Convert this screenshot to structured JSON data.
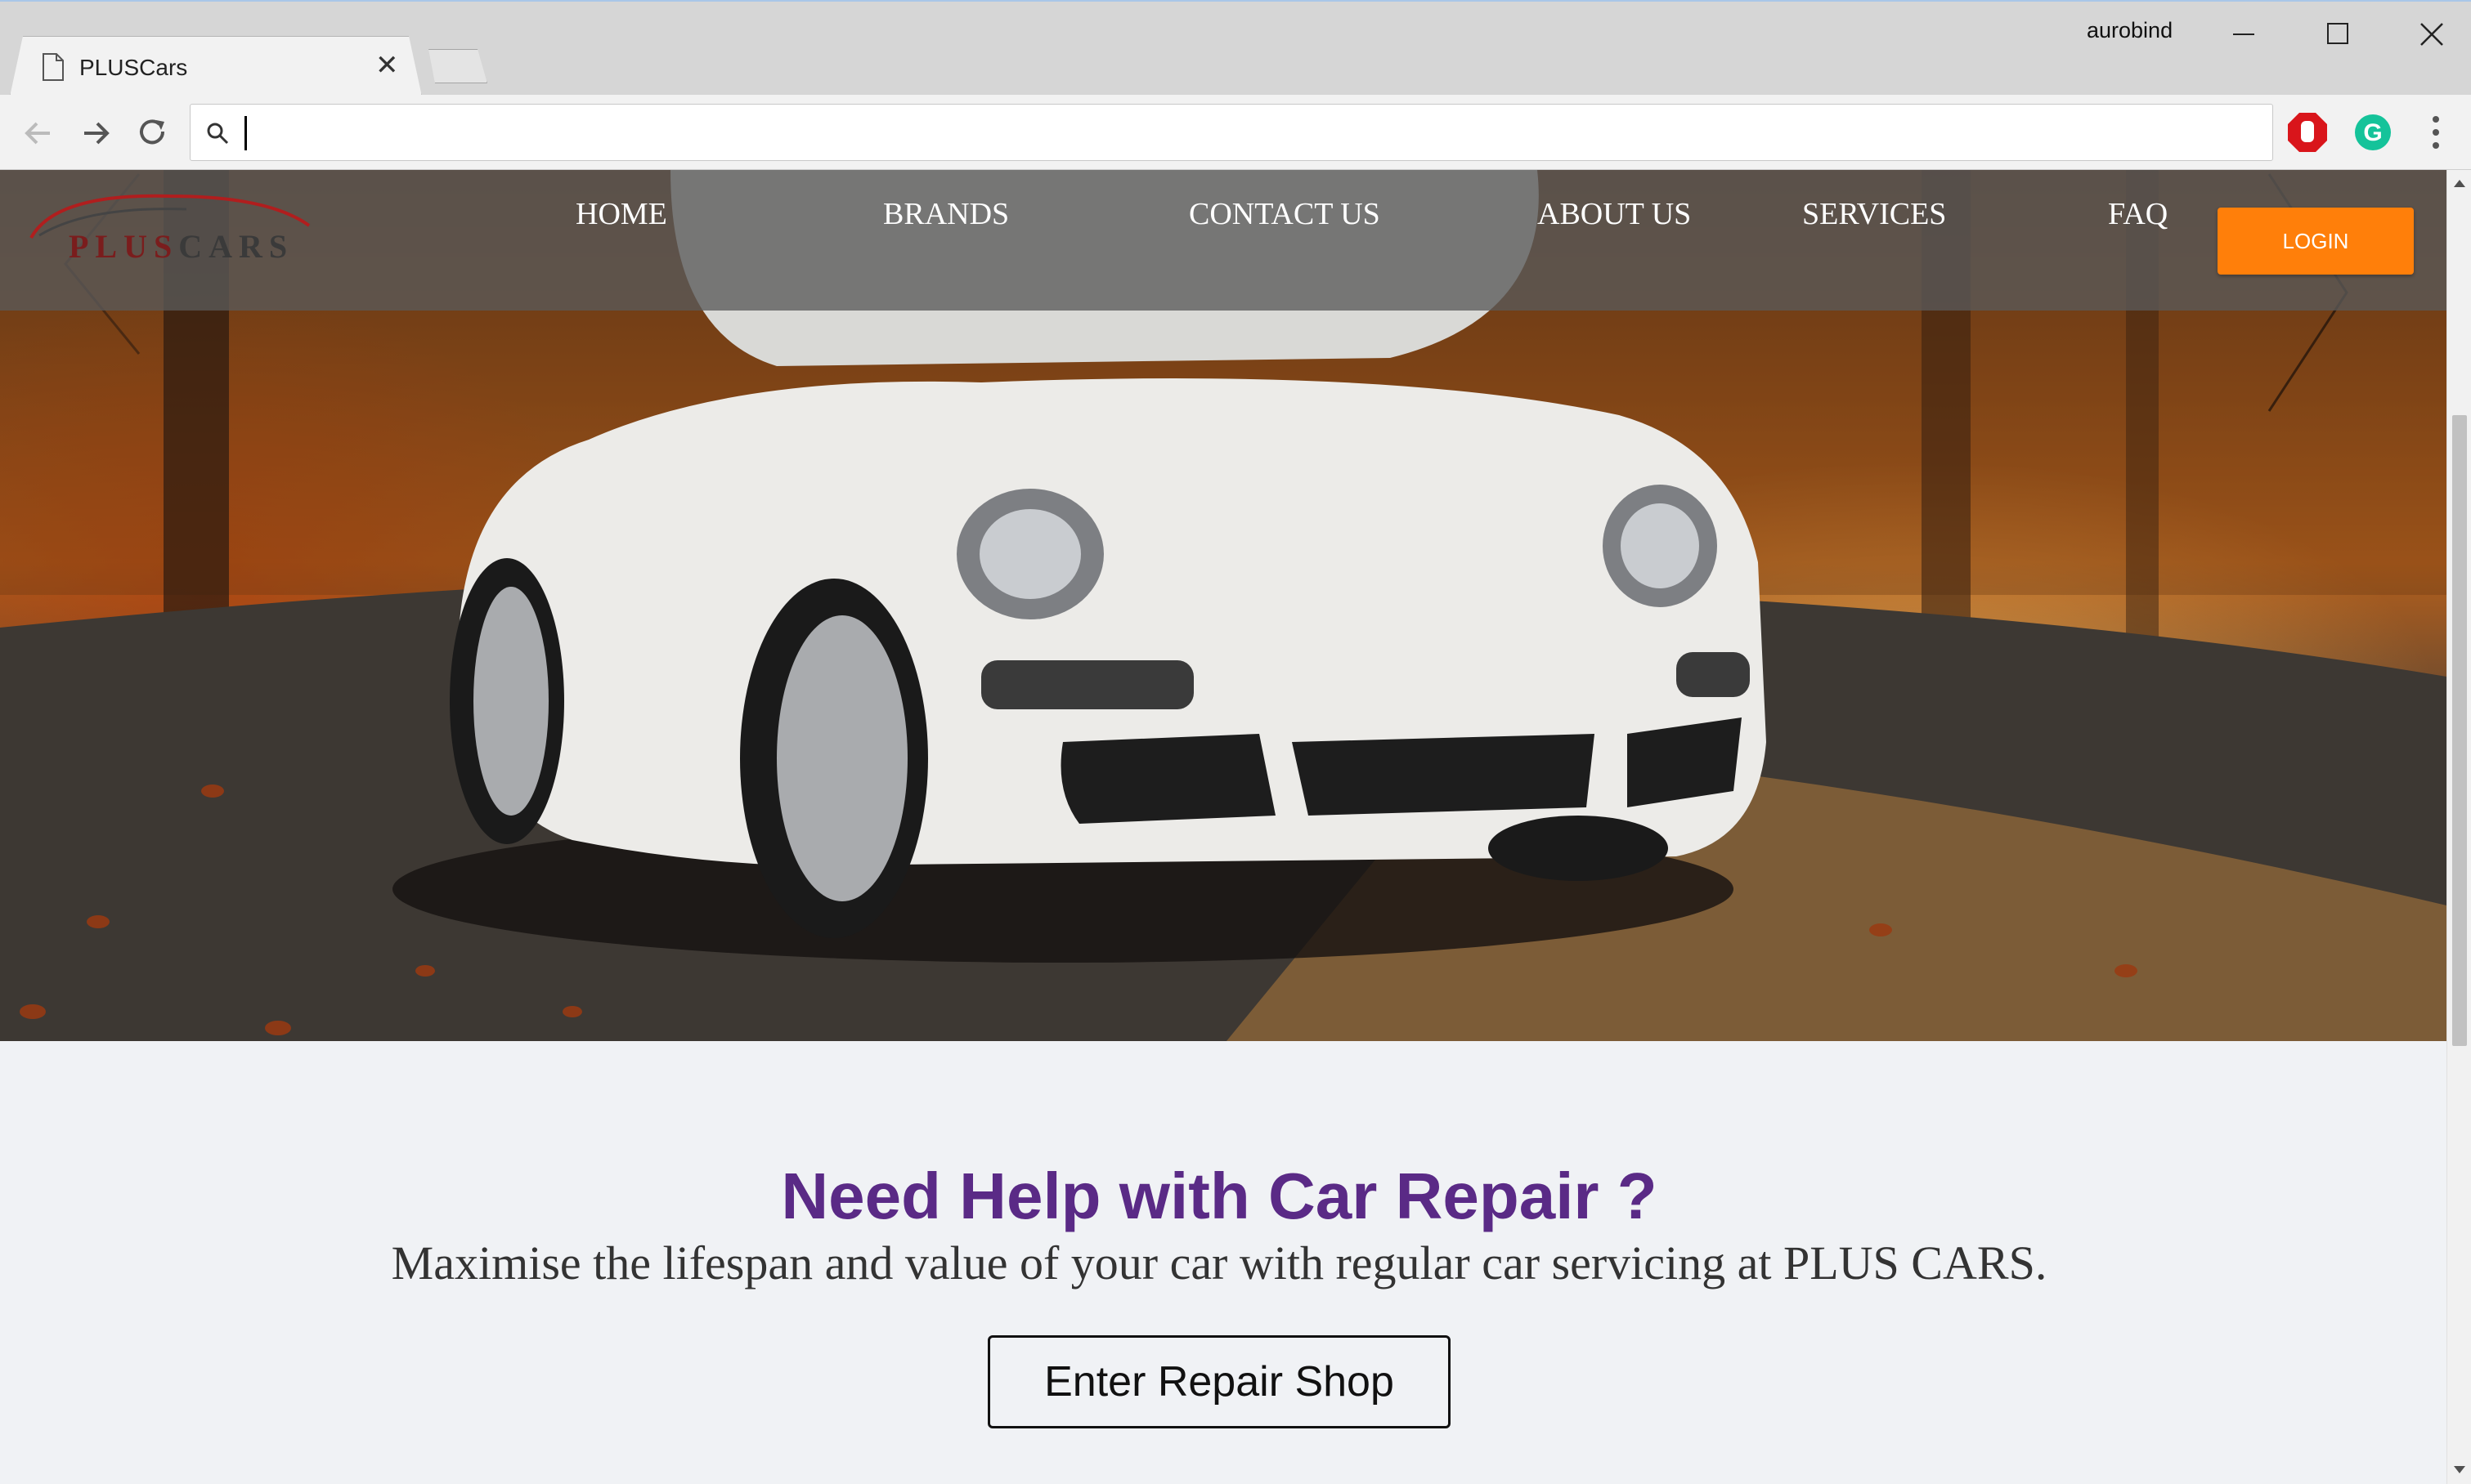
{
  "browser": {
    "tab_title": "PLUSCars",
    "tab_close": "✕",
    "user_name": "aurobind",
    "address_value": "",
    "icons": [
      "page-icon",
      "back-icon",
      "forward-icon",
      "reload-icon",
      "search-icon",
      "adblock-extension-icon",
      "grammarly-extension-icon",
      "menu-icon",
      "minimize-icon",
      "maximize-icon",
      "close-icon"
    ]
  },
  "site": {
    "logo": {
      "plus": "PLUS",
      "cars": "CARS"
    },
    "nav": [
      {
        "label": "HOME"
      },
      {
        "label": "BRANDS"
      },
      {
        "label": "CONTACT US"
      },
      {
        "label": "ABOUT US"
      },
      {
        "label": "SERVICES"
      },
      {
        "label": "FAQ"
      }
    ],
    "login_label": "LOGIN",
    "accent": "#ff7f0a",
    "title_color": "#5a2a86"
  },
  "help": {
    "title": "Need Help with Car Repair ?",
    "subtitle": "Maximise the lifespan and value of your car with regular car servicing at PLUS CARS.",
    "button": "Enter Repair Shop"
  }
}
